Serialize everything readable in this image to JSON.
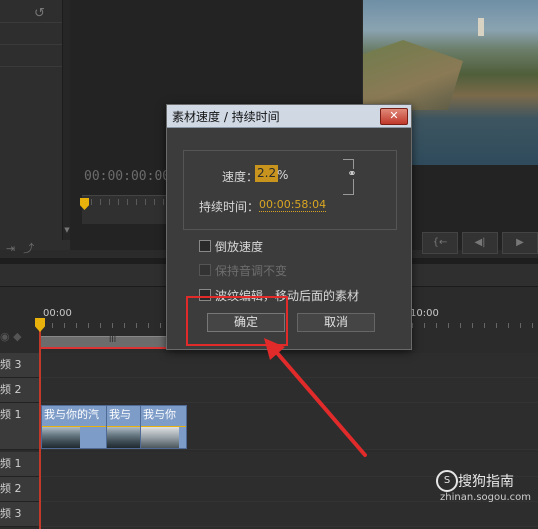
{
  "source_monitor": {
    "timecode": "00:00:00:00"
  },
  "program_controls": [
    "{←",
    "◀|",
    "▶"
  ],
  "timeline": {
    "ruler": {
      "t0": "00:00",
      "t1": "10:00"
    },
    "work_area_label": "III",
    "tracks": [
      {
        "label": "频 3"
      },
      {
        "label": "频 2"
      },
      {
        "label": "频 1"
      },
      {
        "label": "频 1"
      },
      {
        "label": "频 2"
      },
      {
        "label": "频 3"
      }
    ],
    "clips": [
      "我与你的汽",
      "我与",
      "我与你"
    ]
  },
  "dialog": {
    "title": "素材速度 / 持续时间",
    "close_label": "✕",
    "speed_label": "速度：",
    "speed_value": "2.2",
    "speed_unit": "%",
    "duration_label": "持续时间：",
    "duration_value": "00:00:58:04",
    "options": [
      {
        "label": "倒放速度",
        "checked": false,
        "enabled": true
      },
      {
        "label": "保持音调不变",
        "checked": false,
        "enabled": false
      },
      {
        "label": "波纹编辑，移动后面的素材",
        "checked": false,
        "enabled": true
      }
    ],
    "ok_label": "确定",
    "cancel_label": "取消"
  },
  "watermark": {
    "name": "搜狗指南",
    "url": "zhinan.sogou.com"
  },
  "colors": {
    "accent_yellow": "#e8b10c",
    "annotation_red": "#e12a2a",
    "clip_blue": "#7d9cc8"
  }
}
